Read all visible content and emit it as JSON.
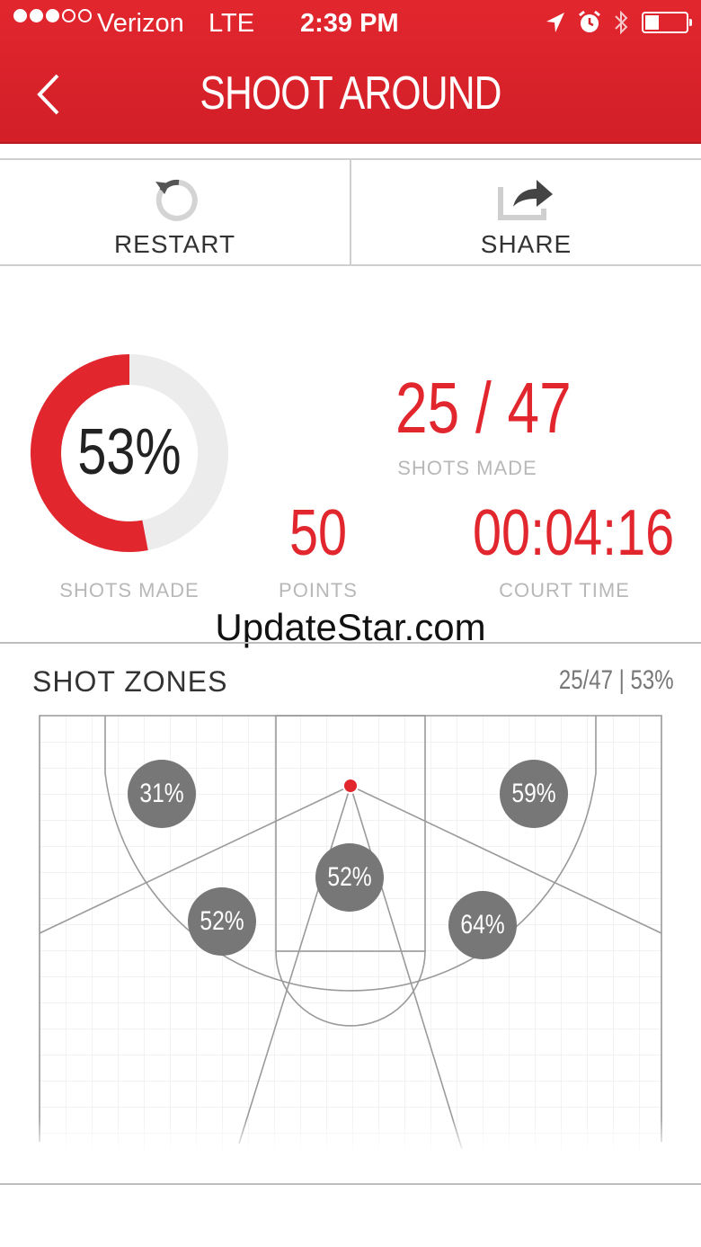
{
  "status_bar": {
    "carrier": "Verizon",
    "network": "LTE",
    "time": "2:39 PM",
    "signal_dots_filled": 3,
    "signal_dots_total": 5,
    "battery_level": 0.35
  },
  "nav": {
    "title": "SHOOT AROUND",
    "back_icon": "chevron-left-icon"
  },
  "actions": {
    "restart_label": "RESTART",
    "share_label": "SHARE"
  },
  "stats": {
    "percent_label": "53%",
    "percent_value": 53,
    "percent_caption": "SHOTS MADE",
    "shots_made": "25 / 47",
    "shots_caption": "SHOTS MADE",
    "points": "50",
    "points_caption": "POINTS",
    "court_time": "00:04:16",
    "court_time_caption": "COURT TIME"
  },
  "watermark": "UpdateStar.com",
  "zones": {
    "title": "SHOT ZONES",
    "summary": "25/47 | 53%",
    "values": {
      "left_corner": "31%",
      "right_corner": "59%",
      "center": "52%",
      "left_wing": "52%",
      "right_wing": "64%"
    }
  },
  "colors": {
    "accent": "#e2262e",
    "ring_track": "#ececec",
    "bubble": "#777777",
    "caption": "#b8b8b8"
  }
}
